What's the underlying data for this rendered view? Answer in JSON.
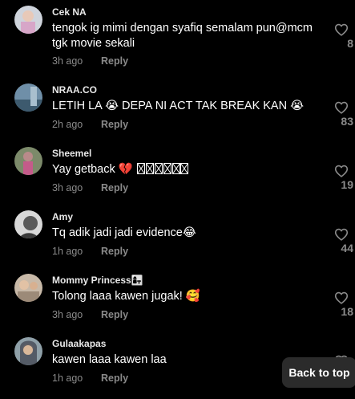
{
  "comments": [
    {
      "username": "Cek NA",
      "text": "tengok ig mimi dengan syafiq semalam pun@mcm tgk movie sekali",
      "time": "3h ago",
      "reply": "Reply",
      "likes": "8"
    },
    {
      "username": "NRAA.CO",
      "text": "LETIH LA 😭 DEPA NI ACT TAK BREAK KAN 😭",
      "time": "2h ago",
      "reply": "Reply",
      "likes": "83"
    },
    {
      "username": "Sheemel",
      "text": "Yay getback 💔",
      "time": "3h ago",
      "reply": "Reply",
      "likes": "19"
    },
    {
      "username": "Amy",
      "text": "Tq adik jadi jadi evidence😂",
      "time": "1h ago",
      "reply": "Reply",
      "likes": "44"
    },
    {
      "username": "Mommy Princess👩‍👧",
      "text": "Tolong laaa kawen jugak! 🥰",
      "time": "3h ago",
      "reply": "Reply",
      "likes": "18"
    },
    {
      "username": "Gulaakapas",
      "text": "kawen laaa kawen laa",
      "time": "1h ago",
      "reply": "Reply",
      "likes": ""
    }
  ],
  "back_to_top_label": "Back to top",
  "colors": {
    "background": "#000000",
    "text": "#ffffff",
    "muted": "#8a8a8a",
    "button_bg": "#2b2b2b"
  },
  "icons": {
    "like": "heart-outline-icon"
  }
}
